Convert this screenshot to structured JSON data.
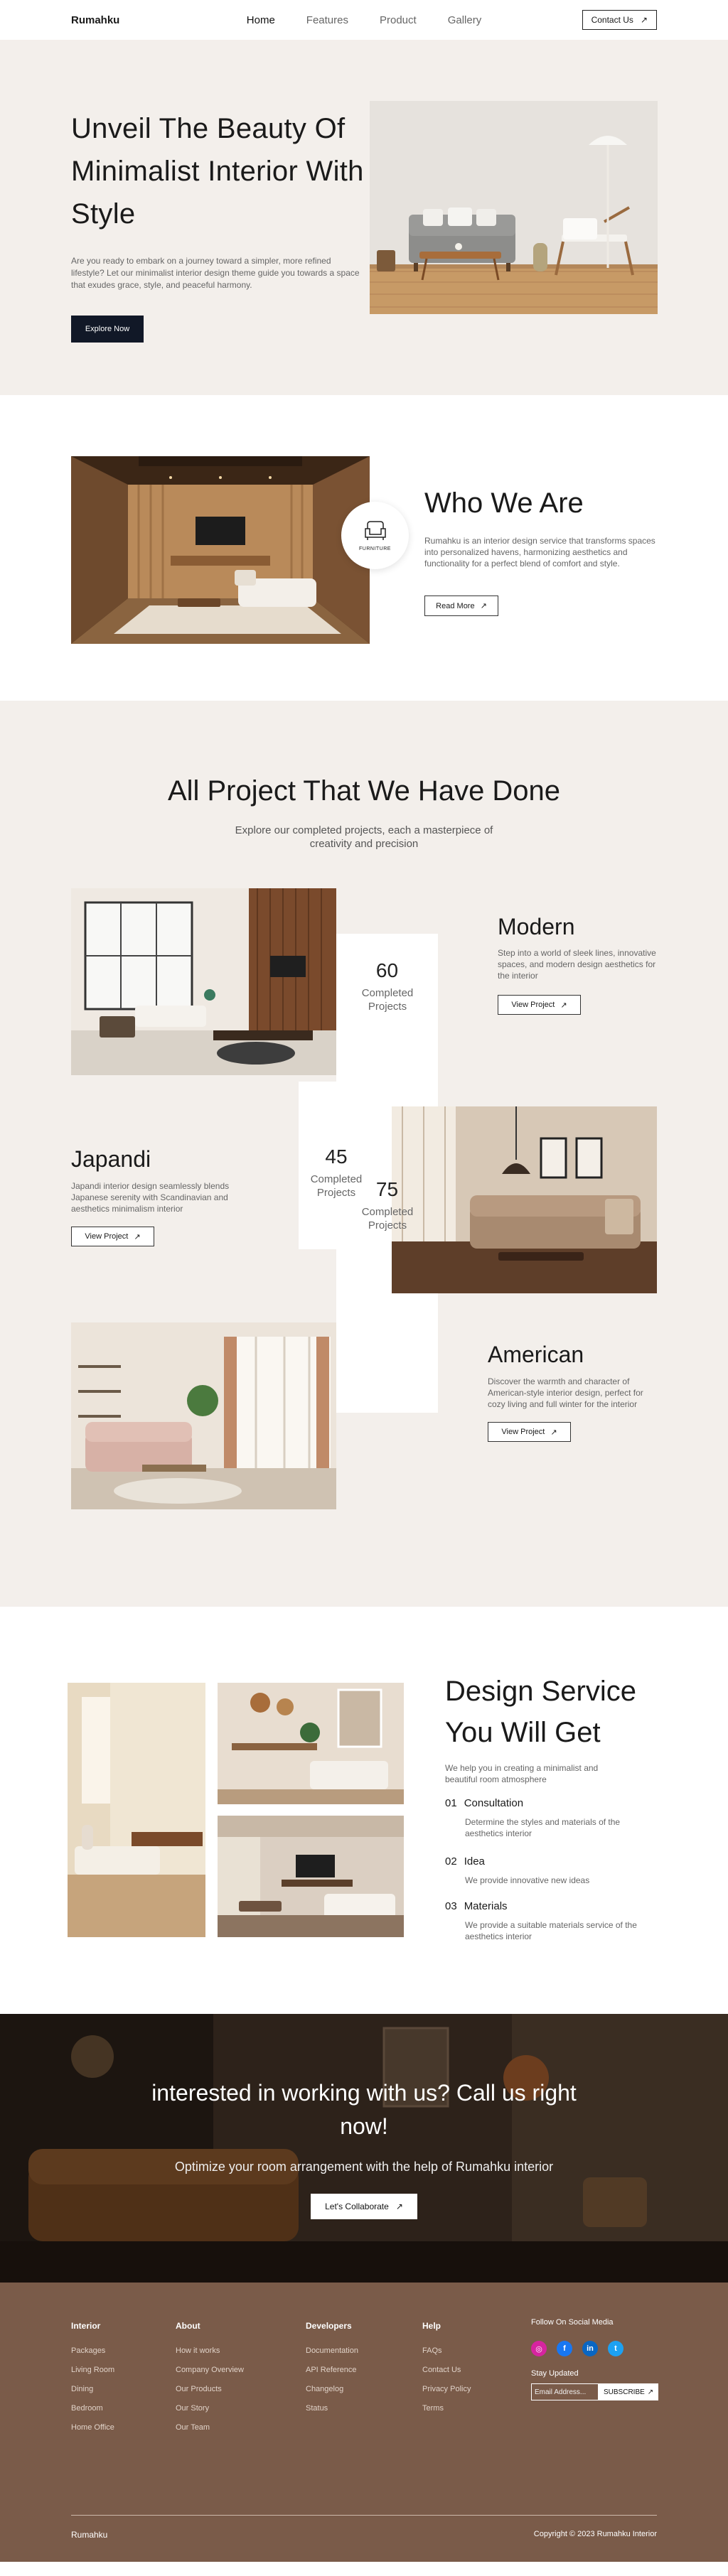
{
  "nav": {
    "brand": "Rumahku",
    "links": [
      "Home",
      "Features",
      "Product",
      "Gallery"
    ],
    "contact_label": "Contact Us"
  },
  "hero": {
    "title": "Unveil The Beauty Of Minimalist Interior With Style",
    "description": "Are you ready to embark on a journey toward a simpler, more refined lifestyle? Let our minimalist interior design theme guide you towards a space that exudes grace, style, and peaceful harmony.",
    "button": "Explore Now"
  },
  "who": {
    "title": "Who We Are",
    "description": "Rumahku is an interior design service that transforms spaces into personalized havens, harmonizing aesthetics and functionality for a perfect blend of comfort and style.",
    "button": "Read More",
    "badge": "FURNITURE"
  },
  "projects": {
    "title": "All Project That We Have Done",
    "subtitle": "Explore our completed projects, each a masterpiece of creativity and precision",
    "items": [
      {
        "name": "Modern",
        "count": "60",
        "count_label": "Completed Projects",
        "description": "Step into a world of sleek lines, innovative spaces, and modern design aesthetics for the interior",
        "button": "View Project"
      },
      {
        "name": "Japandi",
        "count": "45",
        "count_label": "Completed Projects",
        "description": "Japandi interior design seamlessly blends Japanese serenity with Scandinavian and aesthetics minimalism interior",
        "button": "View Project"
      },
      {
        "name": "American",
        "count": "75",
        "count_label": "Completed Projects",
        "description": "Discover the warmth and character of American-style interior design, perfect for cozy living and full winter for the interior",
        "button": "View Project"
      }
    ]
  },
  "service": {
    "title": "Design Service You Will Get",
    "intro": "We help you in creating a minimalist and beautiful room atmosphere",
    "items": [
      {
        "num": "01",
        "title": "Consultation",
        "description": "Determine the styles and materials of the aesthetics interior"
      },
      {
        "num": "02",
        "title": "Idea",
        "description": "We provide innovative new ideas"
      },
      {
        "num": "03",
        "title": "Materials",
        "description": "We provide a suitable materials service of the aesthetics interior"
      }
    ]
  },
  "cta": {
    "title": "interested in working with us? Call us right now!",
    "subtitle": "Optimize your room arrangement with the help of Rumahku interior",
    "button": "Let's Collaborate"
  },
  "footer": {
    "columns": [
      {
        "title": "Interior",
        "items": [
          "Packages",
          "Living Room",
          "Dining",
          "Bedroom",
          "Home Office"
        ]
      },
      {
        "title": "About",
        "items": [
          "How it works",
          "Company Overview",
          "Our Products",
          "Our Story",
          "Our Team"
        ]
      },
      {
        "title": "Developers",
        "items": [
          "Documentation",
          "API Reference",
          "Changelog",
          "Status"
        ]
      },
      {
        "title": "Help",
        "items": [
          "FAQs",
          "Contact Us",
          "Privacy Policy",
          "Terms"
        ]
      }
    ],
    "social_title": "Follow On Social Media",
    "social": [
      {
        "name": "instagram",
        "glyph": "◎",
        "color": "#d6249f"
      },
      {
        "name": "facebook",
        "glyph": "f",
        "color": "#1877f2"
      },
      {
        "name": "linkedin",
        "glyph": "in",
        "color": "#0a66c2"
      },
      {
        "name": "twitter",
        "glyph": "t",
        "color": "#1da1f2"
      }
    ],
    "stay_title": "Stay Updated",
    "email_placeholder": "Email Address...",
    "subscribe": "SUBSCRIBE",
    "brand": "Rumahku",
    "copyright": "Copyright © 2023 Rumahku Interior"
  }
}
